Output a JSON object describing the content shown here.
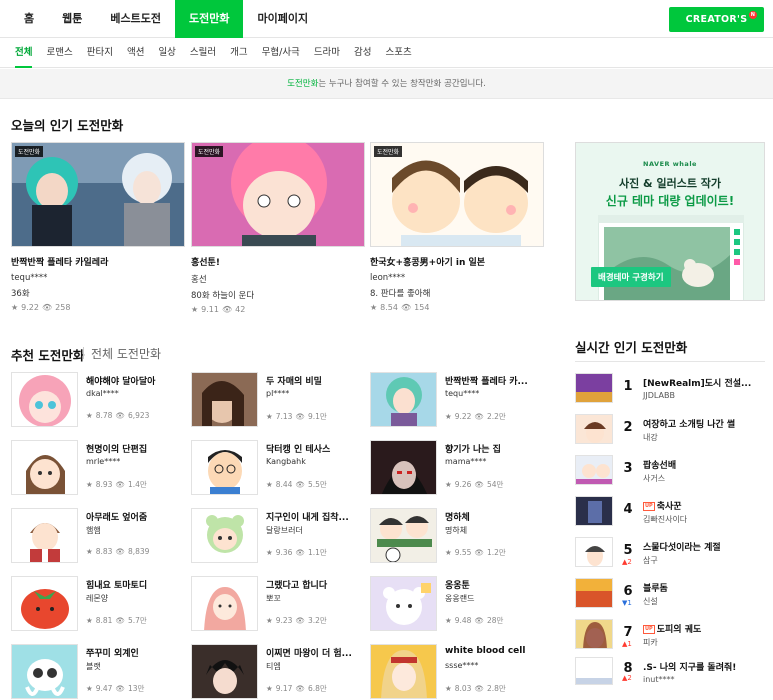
{
  "header": {
    "nav": [
      "홈",
      "웹툰",
      "베스트도전",
      "도전만화",
      "마이페이지"
    ],
    "creators_button": "CREATOR'S",
    "creators_badge": "N"
  },
  "genres": [
    "전체",
    "로맨스",
    "판타지",
    "액션",
    "일상",
    "스릴러",
    "개그",
    "무협/사극",
    "드라마",
    "감성",
    "스포츠"
  ],
  "notice": {
    "highlight": "도전만화",
    "text": "는 누구나 참여할 수 있는 창작만화 공간입니다."
  },
  "popular": {
    "title": "오늘의 인기 도전만화",
    "badge": "도전만화",
    "items": [
      {
        "title": "반짝반짝 플레타 카일레라",
        "author": "tequ****",
        "desc": "36화",
        "rating": "9.22",
        "views": "258"
      },
      {
        "title": "홍선툰!",
        "author": "홍선",
        "desc": "80화 하늘이 운다",
        "rating": "9.11",
        "views": "42"
      },
      {
        "title": "한국女+홍콩男+아기 in 일본",
        "author": "leon****",
        "desc": "8. 판다를 좋아해",
        "rating": "8.54",
        "views": "154"
      }
    ]
  },
  "ad": {
    "brand": "NAVER whale",
    "line1": "사진 & 일러스트 작가",
    "line2": "신규 테마 대량 업데이트!",
    "button": "배경테마 구경하기"
  },
  "recommend": {
    "title": "추천 도전만화",
    "all_link": "전체 도전만화",
    "items": [
      {
        "title": "해야해야 달아달아",
        "author": "dkal****",
        "rating": "8.78",
        "views": "6,923"
      },
      {
        "title": "두 자매의 비밀",
        "author": "pl****",
        "rating": "7.13",
        "views": "9.1만"
      },
      {
        "title": "반짝반짝 플레타 카...",
        "author": "tequ****",
        "rating": "9.22",
        "views": "2.2만"
      },
      {
        "title": "현명이의 단편집",
        "author": "mrle****",
        "rating": "8.93",
        "views": "1.4만"
      },
      {
        "title": "닥터캥 인 테사스",
        "author": "Kangbahk",
        "rating": "8.44",
        "views": "5.5만"
      },
      {
        "title": "향기가 나는 집",
        "author": "mama****",
        "rating": "9.26",
        "views": "54만"
      },
      {
        "title": "아무래도 엎어줌",
        "author": "햄햄",
        "rating": "8.83",
        "views": "8,839"
      },
      {
        "title": "지구인이 내게 집착...",
        "author": "달랑브러더",
        "rating": "9.36",
        "views": "1.1만"
      },
      {
        "title": "명하체",
        "author": "명하체",
        "rating": "9.55",
        "views": "1.2만"
      },
      {
        "title": "힘내요 토마토디",
        "author": "레몬양",
        "rating": "8.81",
        "views": "5.7만"
      },
      {
        "title": "그랬다고 합니다",
        "author": "뽀꼬",
        "rating": "9.23",
        "views": "3.2만"
      },
      {
        "title": "옹옹툰",
        "author": "옹옹랜드",
        "rating": "9.48",
        "views": "28만"
      },
      {
        "title": "쭈꾸미 외계인",
        "author": "블랫",
        "rating": "9.47",
        "views": "13만"
      },
      {
        "title": "이찌면 마왕이 더 험...",
        "author": "티엠",
        "rating": "9.17",
        "views": "6.8만"
      },
      {
        "title": "white blood cell",
        "author": "ssse****",
        "rating": "8.03",
        "views": "2.8만"
      }
    ]
  },
  "ranking": {
    "title": "실시간 인기 도전만화",
    "new_badge": "UP",
    "items": [
      {
        "rank": "1",
        "delta": "",
        "title": "[NewRealm]도시 전설...",
        "author": "JJDLABB",
        "new": false
      },
      {
        "rank": "2",
        "delta": "",
        "title": "여장하고 소개팅 나간 썰",
        "author": "내강",
        "new": false
      },
      {
        "rank": "3",
        "delta": "",
        "title": "팝송선배",
        "author": "사거스",
        "new": false
      },
      {
        "rank": "4",
        "delta": "",
        "title": "축사꾼",
        "author": "김빠진사이다",
        "new": true
      },
      {
        "rank": "5",
        "delta": "▲2",
        "title": "스물다섯이라는 계절",
        "author": "삼구",
        "new": false
      },
      {
        "rank": "6",
        "delta": "▼1",
        "title": "블루돔",
        "author": "신설",
        "new": false
      },
      {
        "rank": "7",
        "delta": "▲1",
        "title": "도피의 궤도",
        "author": "피카",
        "new": true
      },
      {
        "rank": "8",
        "delta": "▲2",
        "title": ".S- 나의 지구를 돌려줘!",
        "author": "inut****",
        "new": false
      }
    ]
  },
  "colors": {
    "brand": "#00c73c",
    "up": "#ff3b30",
    "down": "#2a6fdb"
  }
}
